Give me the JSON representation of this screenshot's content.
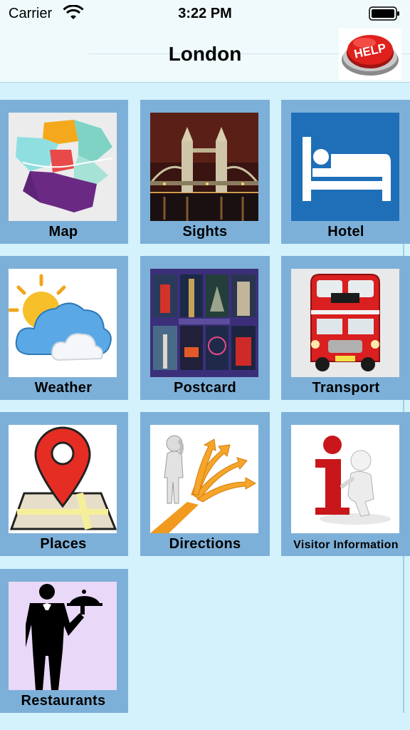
{
  "status_bar": {
    "carrier": "Carrier",
    "time": "3:22 PM",
    "icons": [
      "wifi-icon",
      "battery-icon"
    ]
  },
  "nav": {
    "title": "London",
    "help_label": "HELP"
  },
  "tiles": [
    {
      "label": "Map",
      "icon": "map-icon"
    },
    {
      "label": "Sights",
      "icon": "tower-bridge-icon"
    },
    {
      "label": "Hotel",
      "icon": "bed-icon"
    },
    {
      "label": "Weather",
      "icon": "weather-icon"
    },
    {
      "label": "Postcard",
      "icon": "postcard-icon"
    },
    {
      "label": "Transport",
      "icon": "bus-icon"
    },
    {
      "label": "Places",
      "icon": "map-pin-icon"
    },
    {
      "label": "Directions",
      "icon": "directions-icon"
    },
    {
      "label": "Visitor Information",
      "icon": "info-icon"
    },
    {
      "label": "Restaurants",
      "icon": "waiter-icon"
    }
  ],
  "colors": {
    "background": "#d3f2fc",
    "tile": "#7db0d8",
    "hotel_blue": "#1e6fb8",
    "help_red": "#e0201c"
  }
}
